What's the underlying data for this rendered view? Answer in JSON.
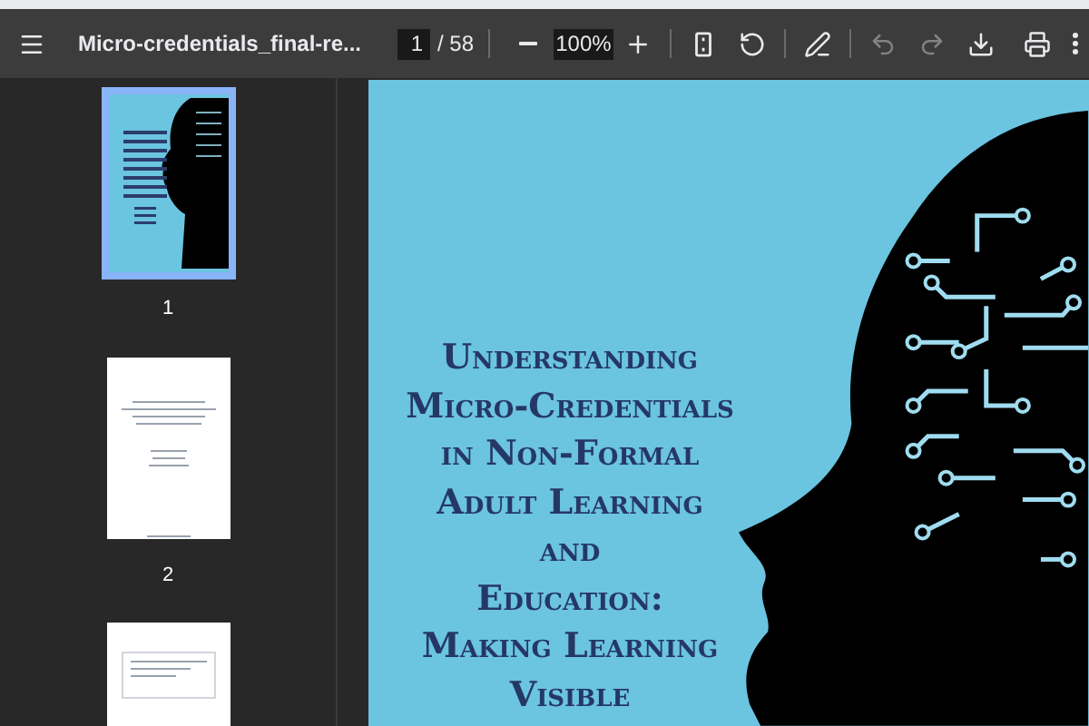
{
  "toolbar": {
    "title": "Micro-credentials_final-re...",
    "page_input": "1",
    "page_total": "/ 58",
    "zoom": "100%",
    "undo_disabled": true,
    "redo_disabled": true
  },
  "thumbnails": [
    {
      "label": "1",
      "kind": "cover",
      "selected": true
    },
    {
      "label": "2",
      "kind": "text",
      "selected": false
    },
    {
      "kind": "table",
      "selected": false
    }
  ],
  "page": {
    "title_lines": [
      "Understanding",
      "Micro-Credentials",
      "in Non-Formal",
      "Adult Learning",
      "and",
      "Education:",
      "Making Learning",
      "Visible"
    ]
  }
}
